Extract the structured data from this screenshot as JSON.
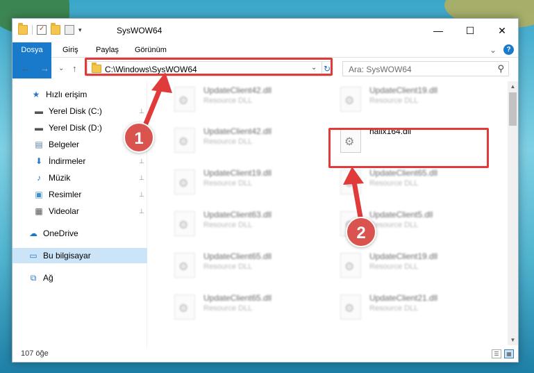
{
  "window": {
    "title": "SysWOW64",
    "minimize_glyph": "—",
    "maximize_glyph": "☐",
    "close_glyph": "✕"
  },
  "ribbon": {
    "tabs": [
      "Dosya",
      "Giriş",
      "Paylaş",
      "Görünüm"
    ],
    "help_glyph": "?",
    "collapse_glyph": "⌄"
  },
  "address": {
    "path": "C:\\Windows\\SysWOW64",
    "back_glyph": "←",
    "forward_glyph": "→",
    "recent_glyph": "⌄",
    "up_glyph": "↑",
    "dropdown_glyph": "⌄",
    "refresh_glyph": "↻"
  },
  "search": {
    "placeholder": "Ara: SysWOW64",
    "icon_glyph": "⚲"
  },
  "navpane": {
    "items": [
      {
        "label": "Hızlı erişim",
        "icon": "star-icon",
        "glyph": "★",
        "color": "#2b79c2",
        "pinned": false
      },
      {
        "label": "Yerel Disk (C:)",
        "icon": "disk-icon",
        "glyph": "▬",
        "color": "#555555",
        "pinned": true
      },
      {
        "label": "Yerel Disk (D:)",
        "icon": "disk-icon",
        "glyph": "▬",
        "color": "#555555",
        "pinned": true
      },
      {
        "label": "Belgeler",
        "icon": "documents-icon",
        "glyph": "▤",
        "color": "#5c7fa3",
        "pinned": true
      },
      {
        "label": "İndirmeler",
        "icon": "download-icon",
        "glyph": "⬇",
        "color": "#2b79c2",
        "pinned": true
      },
      {
        "label": "Müzik",
        "icon": "music-icon",
        "glyph": "♪",
        "color": "#2b79c2",
        "pinned": true
      },
      {
        "label": "Resimler",
        "icon": "pictures-icon",
        "glyph": "▣",
        "color": "#3f8fc9",
        "pinned": true
      },
      {
        "label": "Videolar",
        "icon": "videos-icon",
        "glyph": "▦",
        "color": "#555555",
        "pinned": true
      },
      {
        "label": "OneDrive",
        "icon": "onedrive-icon",
        "glyph": "☁",
        "color": "#1979ca",
        "pinned": false
      },
      {
        "label": "Bu bilgisayar",
        "icon": "computer-icon",
        "glyph": "▭",
        "color": "#2b79c2",
        "pinned": false
      },
      {
        "label": "Ağ",
        "icon": "network-icon",
        "glyph": "⧉",
        "color": "#2b79c2",
        "pinned": false
      }
    ],
    "pin_glyph": "📌"
  },
  "files": [
    {
      "name": "UpdateClient42.dll",
      "type": "Resource DLL",
      "blurred": true
    },
    {
      "name": "UpdateClient19.dll",
      "type": "Resource DLL",
      "blurred": true
    },
    {
      "name": "UpdateClient42.dll",
      "type": "Resource DLL",
      "blurred": true
    },
    {
      "name": "hallx164.dll",
      "type": "",
      "blurred": false
    },
    {
      "name": "UpdateClient19.dll",
      "type": "Resource DLL",
      "blurred": true
    },
    {
      "name": "UpdateClient65.dll",
      "type": "Resource DLL",
      "blurred": true
    },
    {
      "name": "UpdateClient63.dll",
      "type": "Resource DLL",
      "blurred": true
    },
    {
      "name": "UpdateClient5.dll",
      "type": "Resource DLL",
      "blurred": true
    },
    {
      "name": "UpdateClient65.dll",
      "type": "Resource DLL",
      "blurred": true
    },
    {
      "name": "UpdateClient19.dll",
      "type": "Resource DLL",
      "blurred": true
    },
    {
      "name": "UpdateClient65.dll",
      "type": "Resource DLL",
      "blurred": true
    },
    {
      "name": "UpdateClient21.dll",
      "type": "Resource DLL",
      "blurred": true
    }
  ],
  "status": {
    "item_count": "107 öğe"
  },
  "annotations": {
    "marker1": "1",
    "marker2": "2",
    "color": "#e03a3a"
  }
}
